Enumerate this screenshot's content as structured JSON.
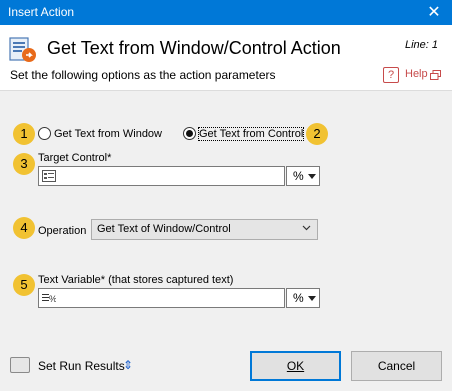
{
  "window": {
    "title": "Insert Action",
    "close_glyph": "✕",
    "titlebar_color": "#0078d7"
  },
  "header": {
    "icon": "get-text-action-icon",
    "title": "Get Text from Window/Control Action",
    "line": "Line: 1",
    "subtitle": "Set the following options as the action parameters",
    "help_icon_glyph": "?",
    "help_label": "Help",
    "accent": "#c74b4b"
  },
  "form": {
    "badge_color": "#f1c232",
    "badges": [
      "1",
      "2",
      "3",
      "4",
      "5"
    ],
    "mode_options": [
      {
        "label": "Get Text from Window",
        "selected": false
      },
      {
        "label": "Get Text from Control",
        "selected": true
      }
    ],
    "target_control": {
      "label": "Target Control*",
      "value": "",
      "var_button": "%"
    },
    "operation": {
      "label": "Operation",
      "selected": "Get Text of Window/Control"
    },
    "text_variable": {
      "label": "Text Variable* (that stores captured text)",
      "value": "",
      "var_button": "%"
    }
  },
  "footer": {
    "set_run_results": "Set Run Results",
    "toggle_glyph": "⇕",
    "ok_label": "OK",
    "cancel_label": "Cancel"
  }
}
